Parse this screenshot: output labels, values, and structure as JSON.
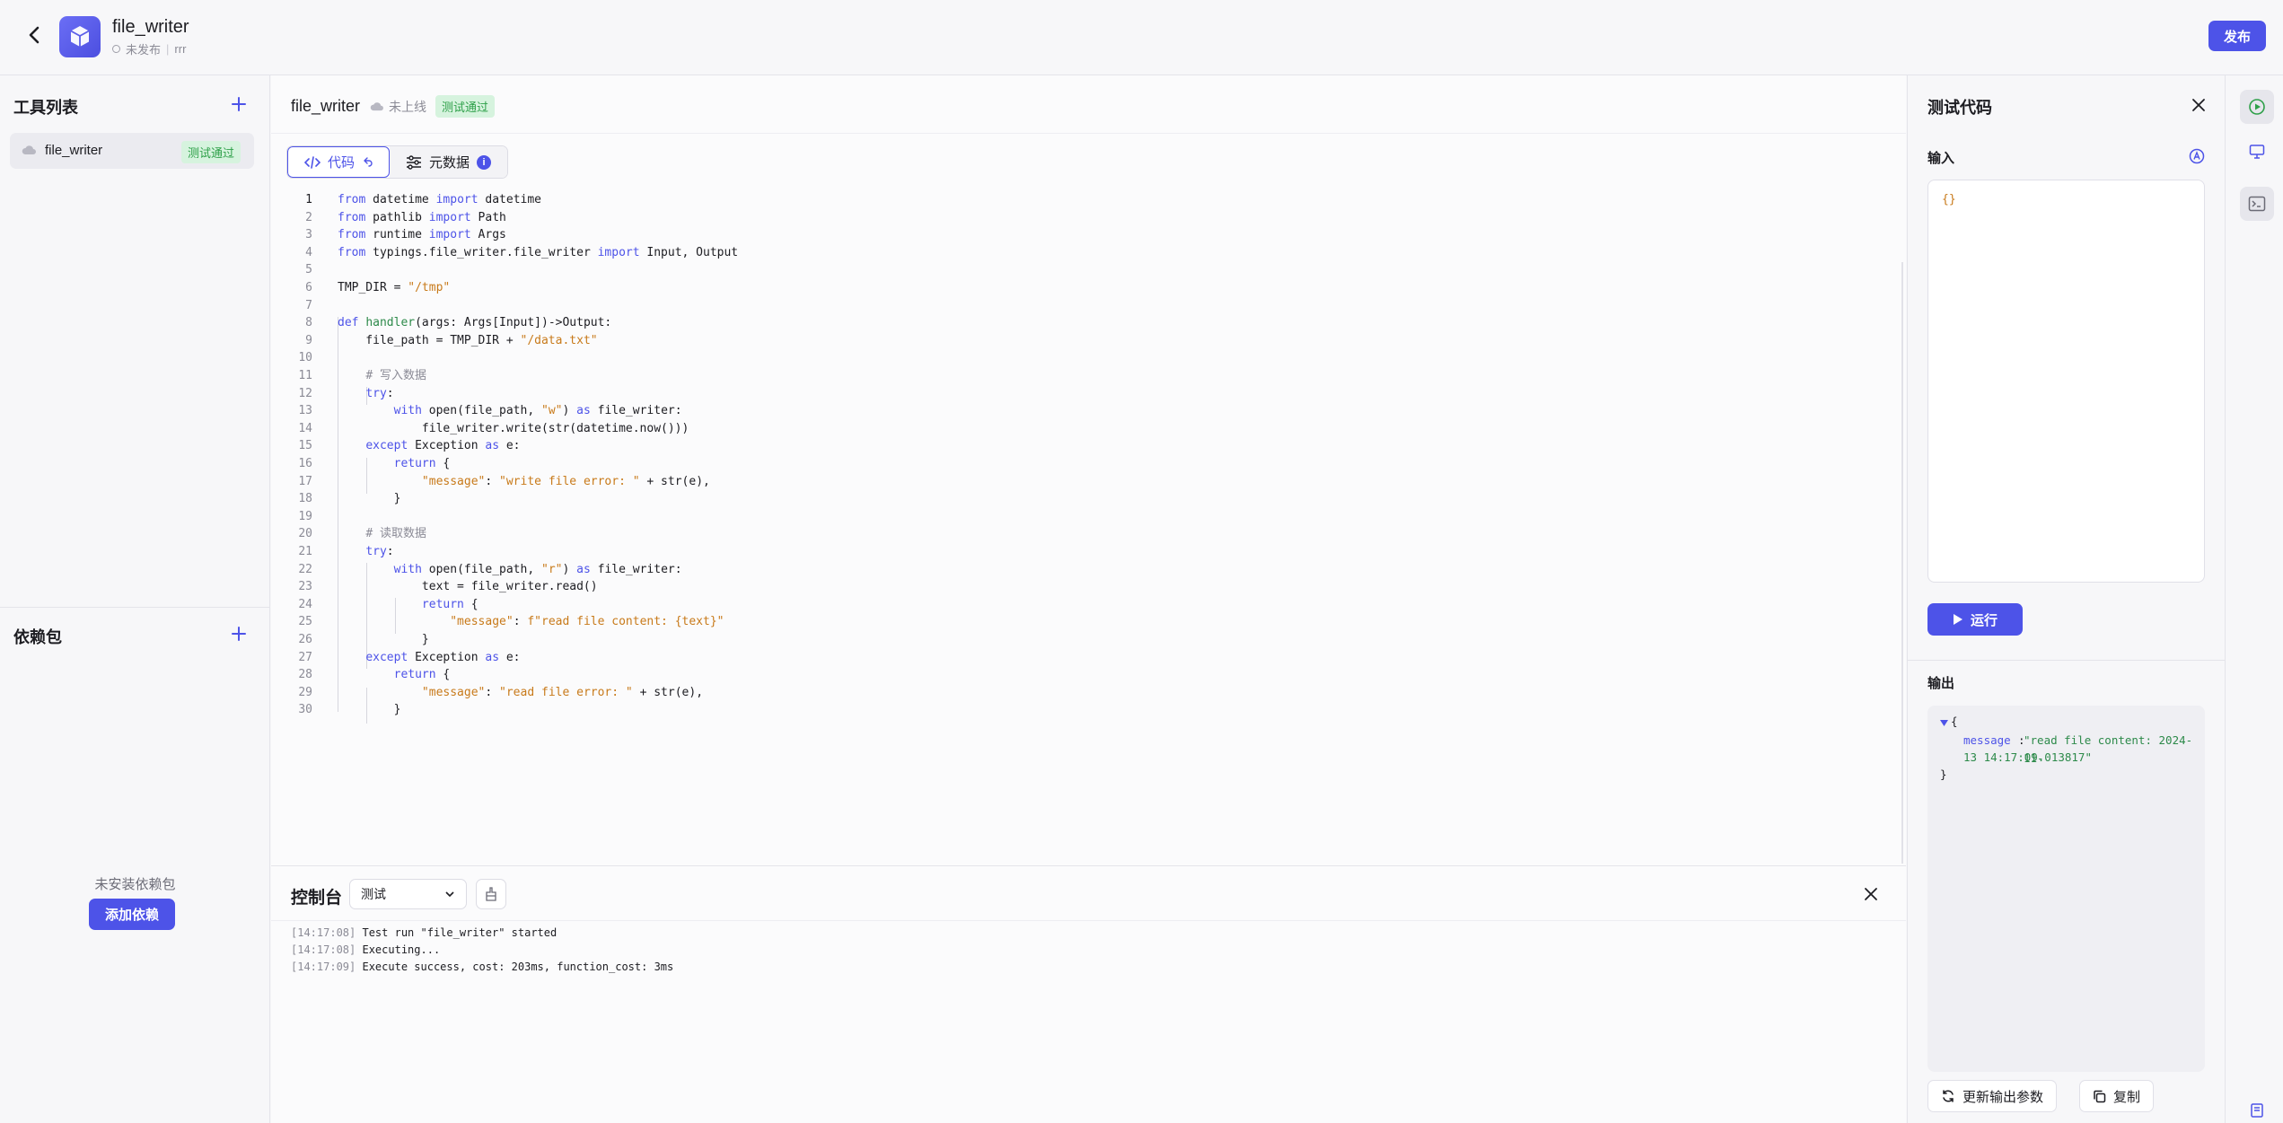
{
  "colors": {
    "accent": "#4d53e8",
    "success_bg": "#d6f3de",
    "success_text": "#2ea049",
    "string": "#c87a1a"
  },
  "header": {
    "title": "file_writer",
    "publish_status": "未发布",
    "separator": "|",
    "owner": "rrr",
    "publish_label": "发布"
  },
  "sidebar": {
    "tools_title": "工具列表",
    "tools": [
      {
        "name": "file_writer",
        "badge": "测试通过"
      }
    ],
    "deps_title": "依赖包",
    "deps_empty": "未安装依赖包",
    "add_dep_label": "添加依赖"
  },
  "main": {
    "file_name": "file_writer",
    "online_status": "未上线",
    "test_badge": "测试通过",
    "tabs": [
      {
        "label": "代码",
        "icon": "code-icon"
      },
      {
        "label": "元数据",
        "icon": "sliders-icon"
      }
    ],
    "info_badge": "i"
  },
  "code_lines": [
    "from datetime import datetime",
    "from pathlib import Path",
    "from runtime import Args",
    "from typings.file_writer.file_writer import Input, Output",
    "",
    "TMP_DIR = \"/tmp\"",
    "",
    "def handler(args: Args[Input])->Output:",
    "    file_path = TMP_DIR + \"/data.txt\"",
    "",
    "    # 写入数据",
    "    try:",
    "        with open(file_path, \"w\") as file_writer:",
    "            file_writer.write(str(datetime.now()))",
    "    except Exception as e:",
    "        return {",
    "            \"message\": \"write file error: \" + str(e),",
    "        }",
    "",
    "    # 读取数据",
    "    try:",
    "        with open(file_path, \"r\") as file_writer:",
    "            text = file_writer.read()",
    "            return {",
    "                \"message\": f\"read file content: {text}\"",
    "            }",
    "    except Exception as e:",
    "        return {",
    "            \"message\": \"read file error: \" + str(e),",
    "        }"
  ],
  "console": {
    "title": "控制台",
    "select_value": "测试",
    "logs": [
      {
        "time": "[14:17:08]",
        "text": " Test run \"file_writer\" started"
      },
      {
        "time": "[14:17:08]",
        "text": " Executing..."
      },
      {
        "time": "[14:17:09]",
        "text": " Execute success, cost: 203ms, function_cost: 3ms"
      }
    ]
  },
  "test_panel": {
    "title": "测试代码",
    "input_label": "输入",
    "input_value": "{}",
    "run_label": "运行",
    "output_label": "输出",
    "output": {
      "open_brace": "{",
      "key": "message",
      "colon": ":",
      "value_line1": "\"read file content: 2024-11-",
      "value_line2": "13 14:17:09.013817\"",
      "close_brace": "}"
    },
    "update_label": "更新输出参数",
    "copy_label": "复制"
  }
}
